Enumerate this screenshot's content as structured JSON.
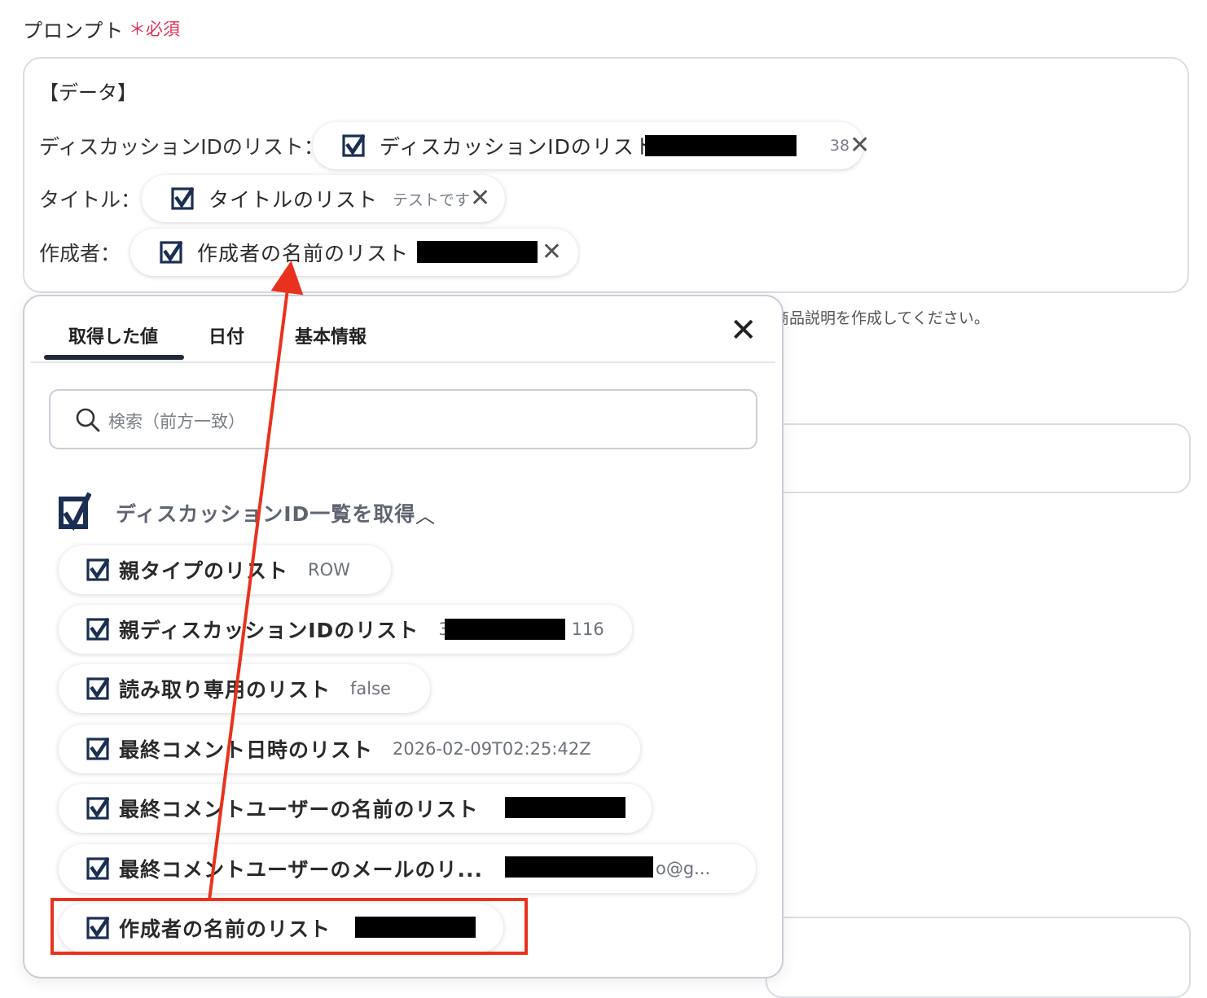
{
  "field": {
    "label": "プロンプト",
    "required": "＊必須"
  },
  "prompt": {
    "heading": "【データ】",
    "rows": [
      {
        "label": "ディスカッションIDのリスト：",
        "chip_label": "ディスカッションIDのリスト",
        "chip_value": "38"
      },
      {
        "label": "タイトル：",
        "chip_label": "タイトルのリスト",
        "chip_value": "テストです"
      },
      {
        "label": "作成者：",
        "chip_label": "作成者の名前のリスト",
        "chip_value": ""
      }
    ]
  },
  "help_text": "商品説明を作成してください。",
  "panel": {
    "tabs": [
      "取得した値",
      "日付",
      "基本情報"
    ],
    "active_tab": 0,
    "search_placeholder": "検索（前方一致）",
    "group_title": "ディスカッションID一覧を取得",
    "items": [
      {
        "label": "親タイプのリスト",
        "value": "ROW"
      },
      {
        "label": "親ディスカッションIDのリスト",
        "value": "3",
        "value_tail": "116"
      },
      {
        "label": "読み取り専用のリスト",
        "value": "false"
      },
      {
        "label": "最終コメント日時のリスト",
        "value": "2026-02-09T02:25:42Z"
      },
      {
        "label": "最終コメントユーザーの名前のリスト",
        "value": ""
      },
      {
        "label": "最終コメントユーザーのメールのリ...",
        "value": "",
        "value_tail": "o@g..."
      },
      {
        "label": "作成者の名前のリスト",
        "value": ""
      }
    ]
  },
  "colors": {
    "required": "#e0325a",
    "checkbox_brand": "#1b2f52",
    "annotation": "#e8321e"
  },
  "icons": {
    "checkbox": "checkbox-icon",
    "close": "close-icon",
    "search": "search-icon",
    "chevron": "chevron-up-icon"
  }
}
